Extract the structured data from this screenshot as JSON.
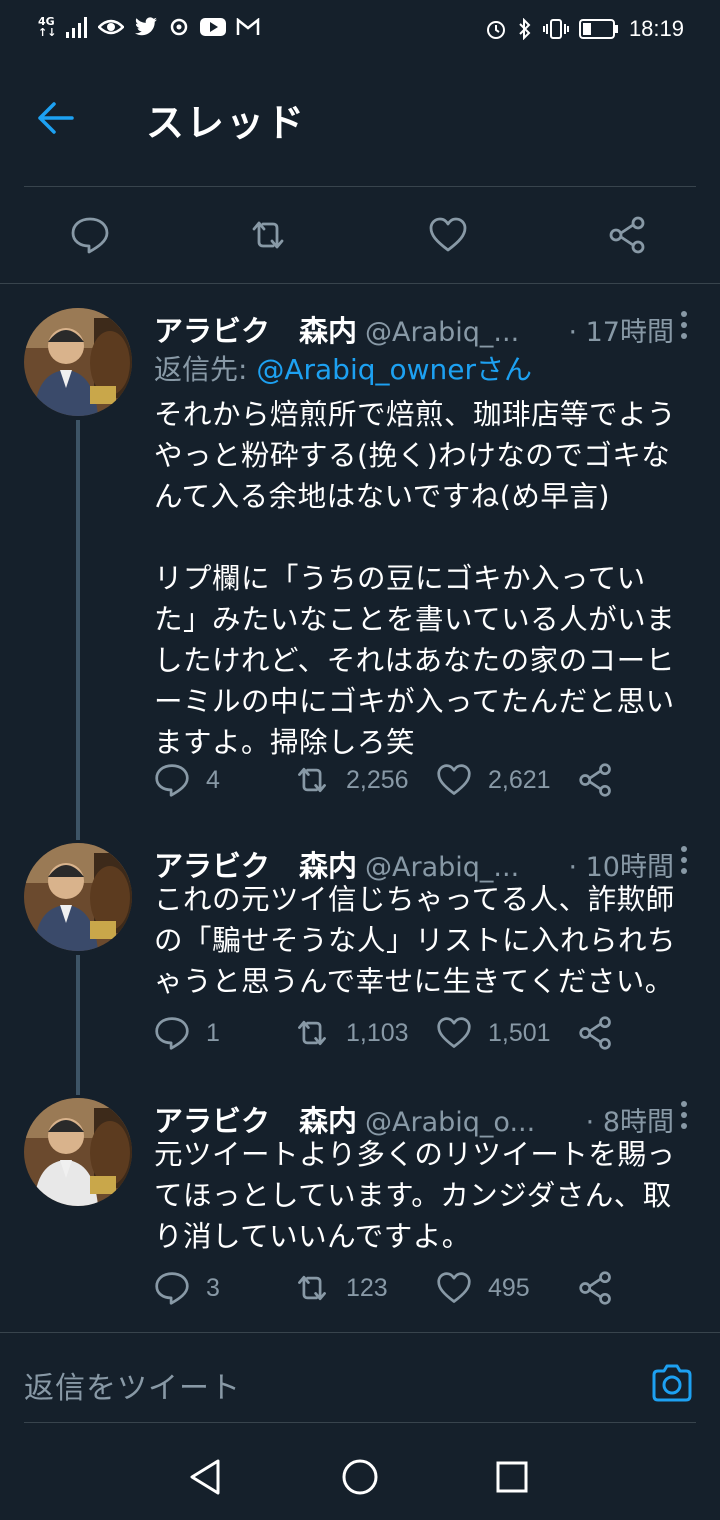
{
  "status_bar": {
    "network_top": "4G",
    "network_bottom": "↑↓",
    "time": "18:19"
  },
  "header": {
    "title": "スレッド"
  },
  "tweets": [
    {
      "name": "アラビク　森内",
      "handle": "@Arabiq_...",
      "time": "· 17時間",
      "reply_prefix": "返信先: ",
      "reply_mention": "@Arabiq_ownerさん",
      "body": [
        "それから焙煎所で焙煎、珈琲店等でよう",
        "やっと粉砕する(挽く)わけなのでゴキな",
        "んて入る余地はないですね(め早言)",
        "",
        "リプ欄に「うちの豆にゴキか入ってい",
        "た」みたいなことを書いている人がいま",
        "したけれど、それはあなたの家のコーヒ",
        "ーミルの中にゴキが入ってたんだと思い",
        "ますよ。掃除しろ笑"
      ],
      "replies": "4",
      "retweets": "2,256",
      "likes": "2,621"
    },
    {
      "name": "アラビク　森内",
      "handle": "@Arabiq_...",
      "time": "· 10時間",
      "body": [
        "これの元ツイ信じちゃってる人、詐欺師",
        "の「騙せそうな人」リストに入れられち",
        "ゃうと思うんで幸せに生きてください。"
      ],
      "replies": "1",
      "retweets": "1,103",
      "likes": "1,501"
    },
    {
      "name": "アラビク　森内",
      "handle": "@Arabiq_o...",
      "time": "· 8時間",
      "body": [
        "元ツイートより多くのリツイートを賜っ",
        "てほっとしています。カンジダさん、取",
        "り消していいんですよ。"
      ],
      "replies": "3",
      "retweets": "123",
      "likes": "495"
    }
  ],
  "compose": {
    "placeholder": "返信をツイート"
  },
  "colors": {
    "background": "#15202b",
    "accent": "#1da1f2",
    "muted": "#8899a6",
    "divider": "#38444d"
  }
}
